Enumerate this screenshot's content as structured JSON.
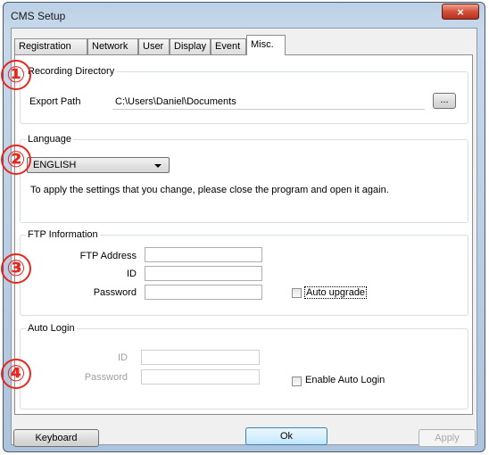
{
  "window": {
    "title": "CMS Setup",
    "close_glyph": "×"
  },
  "tabs": [
    {
      "label": "Registration"
    },
    {
      "label": "Network"
    },
    {
      "label": "User"
    },
    {
      "label": "Display"
    },
    {
      "label": "Event"
    },
    {
      "label": "Misc.",
      "active": true
    }
  ],
  "recording": {
    "title": "Recording Directory",
    "export_label": "Export Path",
    "export_value": "C:\\Users\\Daniel\\Documents",
    "browse_label": "..."
  },
  "language": {
    "title": "Language",
    "selected": "ENGLISH",
    "note": "To apply the settings that you change, please close the program and open it again."
  },
  "ftp": {
    "title": "FTP Information",
    "address_label": "FTP Address",
    "id_label": "ID",
    "password_label": "Password",
    "address_value": "",
    "id_value": "",
    "password_value": "",
    "auto_upgrade_label": "Auto upgrade",
    "auto_upgrade_checked": false
  },
  "auto_login": {
    "title": "Auto Login",
    "id_label": "ID",
    "password_label": "Password",
    "id_value": "",
    "password_value": "",
    "enable_label": "Enable Auto Login",
    "enable_checked": false
  },
  "footer": {
    "keyboard_label": "Keyboard",
    "ok_label": "Ok",
    "apply_label": "Apply"
  },
  "annotations": [
    "①",
    "②",
    "③",
    "④"
  ],
  "colors": {
    "annotation": "#e8261e",
    "title_bar": "#c7d8ea",
    "close_button": "#d2503a"
  },
  "icons": {
    "dropdown": "chevron-down-icon",
    "close": "close-icon"
  }
}
